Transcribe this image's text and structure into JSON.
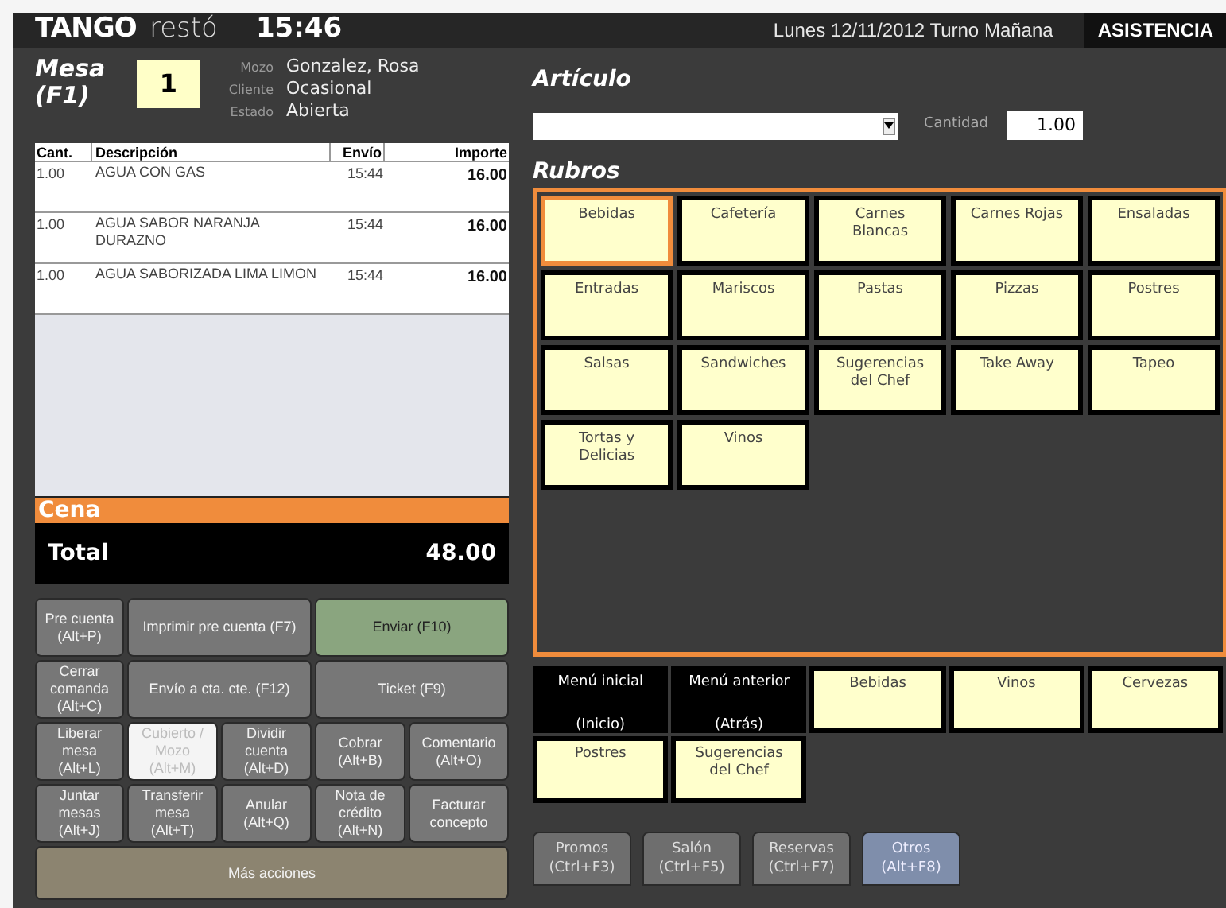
{
  "header": {
    "logo_bold": "TANGO",
    "logo_light": "restó",
    "time": "15:46",
    "date_shift": "Lunes 12/11/2012 Turno Mañana",
    "mode": "ASISTENCIA"
  },
  "mesa": {
    "label": "Mesa\n(F1)",
    "number": "1",
    "fields": [
      {
        "label": "Mozo",
        "value": "Gonzalez, Rosa"
      },
      {
        "label": "Cliente",
        "value": "Ocasional"
      },
      {
        "label": "Estado",
        "value": "Abierta"
      }
    ]
  },
  "table": {
    "columns": [
      "Cant.",
      "Descripción",
      "Envío",
      "Importe"
    ],
    "rows": [
      {
        "qty": "1.00",
        "description": "AGUA CON GAS",
        "sent": "15:44",
        "amount": "16.00"
      },
      {
        "qty": "1.00",
        "description": "AGUA SABOR NARANJA DURAZNO",
        "sent": "15:44",
        "amount": "16.00"
      },
      {
        "qty": "1.00",
        "description": "AGUA SABORIZADA LIMA LIMON",
        "sent": "15:44",
        "amount": "16.00"
      }
    ]
  },
  "meal": "Cena",
  "total": {
    "label": "Total",
    "value": "48.00"
  },
  "actions": [
    {
      "label": "Pre cuenta (Alt+P)",
      "kind": "small",
      "disabled": false
    },
    {
      "label": "Imprimir pre cuenta (F7)",
      "kind": "wide",
      "disabled": false
    },
    {
      "label": "Enviar (F10)",
      "kind": "primary",
      "disabled": false
    },
    {
      "label": "Cerrar comanda (Alt+C)",
      "kind": "small",
      "disabled": false
    },
    {
      "label": "Envío a cta. cte. (F12)",
      "kind": "wide",
      "disabled": false
    },
    {
      "label": "Ticket (F9)",
      "kind": "wide",
      "disabled": false
    },
    {
      "label": "Liberar mesa (Alt+L)",
      "kind": "small",
      "disabled": false
    },
    {
      "label": "Cubierto / Mozo (Alt+M)",
      "kind": "small",
      "disabled": true
    },
    {
      "label": "Dividir cuenta (Alt+D)",
      "kind": "small",
      "disabled": false
    },
    {
      "label": "Cobrar (Alt+B)",
      "kind": "small",
      "disabled": false
    },
    {
      "label": "Comentario (Alt+O)",
      "kind": "small",
      "disabled": false
    },
    {
      "label": "Juntar mesas (Alt+J)",
      "kind": "small",
      "disabled": false
    },
    {
      "label": "Transferir mesa (Alt+T)",
      "kind": "small",
      "disabled": false
    },
    {
      "label": "Anular (Alt+Q)",
      "kind": "small",
      "disabled": false
    },
    {
      "label": "Nota de crédito (Alt+N)",
      "kind": "small",
      "disabled": false
    },
    {
      "label": "Facturar concepto",
      "kind": "small",
      "disabled": false
    },
    {
      "label": "Más acciones",
      "kind": "more",
      "disabled": false
    }
  ],
  "articulo": {
    "title": "Artículo",
    "quantity_label": "Cantidad",
    "quantity": "1.00"
  },
  "rubros": {
    "title": "Rubros",
    "items": [
      {
        "label": "Bebidas",
        "selected": true
      },
      {
        "label": "Cafetería",
        "selected": false
      },
      {
        "label": "Carnes Blancas",
        "selected": false
      },
      {
        "label": "Carnes Rojas",
        "selected": false
      },
      {
        "label": "Ensaladas",
        "selected": false
      },
      {
        "label": "Entradas",
        "selected": false
      },
      {
        "label": "Mariscos",
        "selected": false
      },
      {
        "label": "Pastas",
        "selected": false
      },
      {
        "label": "Pizzas",
        "selected": false
      },
      {
        "label": "Postres",
        "selected": false
      },
      {
        "label": "Salsas",
        "selected": false
      },
      {
        "label": "Sandwiches",
        "selected": false
      },
      {
        "label": "Sugerencias del Chef",
        "selected": false
      },
      {
        "label": "Take Away",
        "selected": false
      },
      {
        "label": "Tapeo",
        "selected": false
      },
      {
        "label": "Tortas y Delicias",
        "selected": false
      },
      {
        "label": "Vinos",
        "selected": false
      }
    ]
  },
  "shortcuts": [
    {
      "label": "Menú inicial",
      "key": "(Inicio)",
      "kind": "nav"
    },
    {
      "label": "Menú anterior",
      "key": "(Atrás)",
      "kind": "nav"
    },
    {
      "label": "Bebidas",
      "kind": "item"
    },
    {
      "label": "Vinos",
      "kind": "item"
    },
    {
      "label": "Cervezas",
      "kind": "item"
    },
    {
      "label": "Postres",
      "kind": "item"
    },
    {
      "label": "Sugerencias del Chef",
      "kind": "item"
    }
  ],
  "tabs": [
    {
      "label": "Promos (Ctrl+F3)",
      "selected": false
    },
    {
      "label": "Salón (Ctrl+F5)",
      "selected": false
    },
    {
      "label": "Reservas (Ctrl+F7)",
      "selected": false
    },
    {
      "label": "Otros (Alt+F8)",
      "selected": true
    }
  ]
}
